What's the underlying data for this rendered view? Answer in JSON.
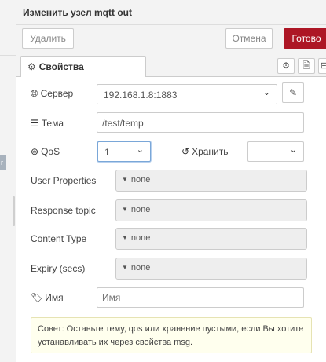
{
  "tray": {
    "title": "Изменить узел mqtt out",
    "buttons": {
      "delete": "Удалить",
      "cancel": "Отмена",
      "done": "Готово"
    },
    "tabs": {
      "properties": "Свойства"
    }
  },
  "fields": {
    "server": {
      "label": "Сервер",
      "value": "192.168.1.8:1883"
    },
    "topic": {
      "label": "Тема",
      "value": "/test/temp"
    },
    "qos": {
      "label": "QoS",
      "value": "1"
    },
    "retain": {
      "label": "Хранить",
      "value": ""
    },
    "user_properties": {
      "label": "User Properties",
      "value": "none"
    },
    "response_topic": {
      "label": "Response topic",
      "value": "none"
    },
    "content_type": {
      "label": "Content Type",
      "value": "none"
    },
    "expiry": {
      "label": "Expiry (secs)",
      "value": "none"
    },
    "name": {
      "label": "Имя",
      "placeholder": "Имя"
    }
  },
  "tip": "Совет: Оставьте тему, qos или хранение пустыми, если Вы хотите устанавливать их через свойства msg."
}
